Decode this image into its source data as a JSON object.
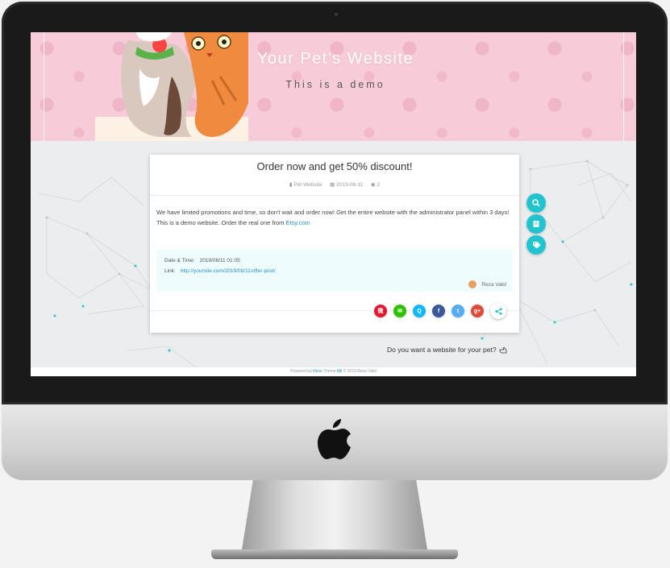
{
  "header": {
    "site_title": "Your Pet's Website",
    "subtitle": "This is a demo"
  },
  "post": {
    "title": "Order now and get 50% discount!",
    "meta": {
      "category": "Pet Website",
      "category_icon": "book-icon",
      "date": "2019-08-11",
      "date_icon": "calendar-icon",
      "views": "2",
      "views_icon": "eye-icon"
    },
    "body_line1": "We have limited promotions and time, so don't wait and order now! Get the entire website with the administrator panel within 3 days!",
    "body_line2_prefix": "This is a demo website. Order the real one from",
    "body_link": "Etsy.com"
  },
  "info": {
    "date_label": "Date & Time:",
    "date_value": "2019/08/11 01:05",
    "link_label": "Link:",
    "link_value": "http://yoursite.com/2019/08/11/offer-post/",
    "author": "Reza Vakil"
  },
  "share": {
    "buttons": [
      {
        "name": "weibo",
        "icon": "weibo-icon",
        "color": "#e6162d",
        "glyph": "微"
      },
      {
        "name": "wechat",
        "icon": "wechat-icon",
        "color": "#2dc100",
        "glyph": "✉"
      },
      {
        "name": "qq",
        "icon": "qq-icon",
        "color": "#12b7f5",
        "glyph": "Q"
      },
      {
        "name": "facebook",
        "icon": "facebook-icon",
        "color": "#3b5998",
        "glyph": "f"
      },
      {
        "name": "twitter",
        "icon": "twitter-icon",
        "color": "#55acee",
        "glyph": "t"
      },
      {
        "name": "google-plus",
        "icon": "google-plus-icon",
        "color": "#dd4b39",
        "glyph": "g+"
      }
    ],
    "toggle_icon": "share-icon",
    "toggle_color": "#20c3cf"
  },
  "floating_buttons": [
    {
      "name": "search",
      "icon": "search-icon"
    },
    {
      "name": "archive",
      "icon": "book-icon"
    },
    {
      "name": "tags",
      "icon": "tags-icon"
    }
  ],
  "cta": {
    "text": "Do you want a website for your pet?",
    "icon": "hand-pointer-icon"
  },
  "footer": {
    "powered": "Powered by",
    "hexo": "Hexo",
    "theme": "Theme",
    "theme_name": "Mil",
    "copyright": "© 2019 Reza Vakil"
  },
  "colors": {
    "accent": "#20c3cf",
    "banner_pink": "#f8cbd8",
    "link": "#2a8fc4"
  }
}
